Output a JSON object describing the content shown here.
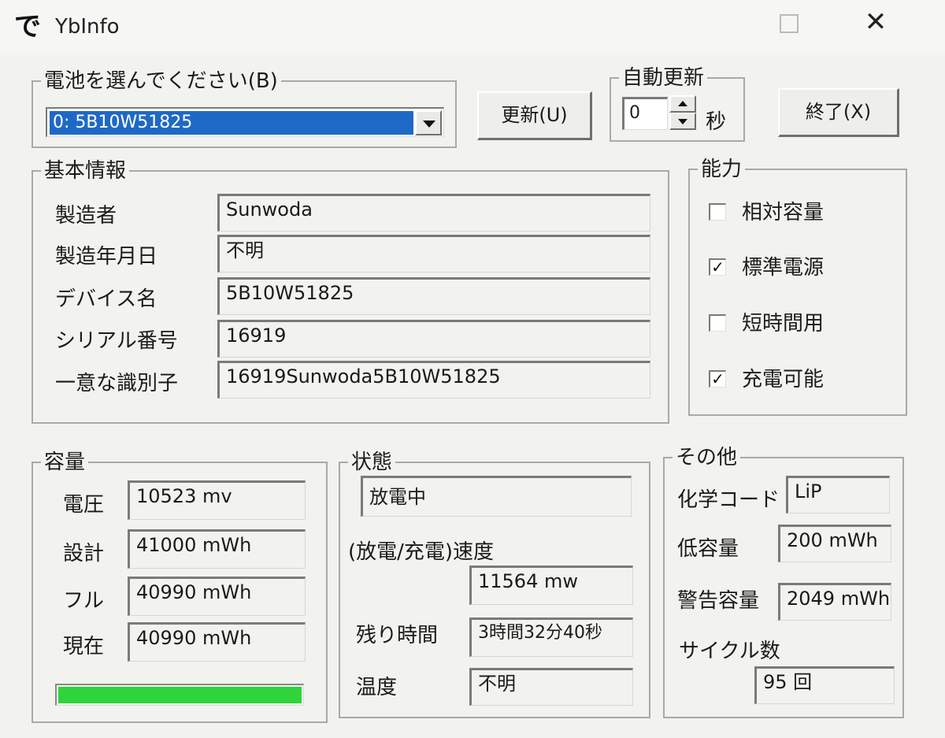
{
  "window": {
    "title": "YbInfo",
    "app_icon": "で",
    "close_glyph": "✕"
  },
  "battery_select": {
    "legend": "電池を選んでください(B)",
    "selected": "0: 5B10W51825",
    "refresh_label": "更新(U)"
  },
  "auto_update": {
    "legend": "自動更新",
    "value": "0",
    "unit": "秒"
  },
  "exit_label": "終了(X)",
  "basic_info": {
    "legend": "基本情報",
    "fields": [
      {
        "label": "製造者",
        "value": "Sunwoda"
      },
      {
        "label": "製造年月日",
        "value": "不明"
      },
      {
        "label": "デバイス名",
        "value": "5B10W51825"
      },
      {
        "label": "シリアル番号",
        "value": "16919"
      },
      {
        "label": "一意な識別子",
        "value": "16919Sunwoda5B10W51825"
      }
    ]
  },
  "capability": {
    "legend": "能力",
    "items": [
      {
        "label": "相対容量",
        "checked": false,
        "mark": ""
      },
      {
        "label": "標準電源",
        "checked": true,
        "mark": "✓"
      },
      {
        "label": "短時間用",
        "checked": false,
        "mark": ""
      },
      {
        "label": "充電可能",
        "checked": true,
        "mark": "✓"
      }
    ]
  },
  "capacity": {
    "legend": "容量",
    "fields": [
      {
        "label": "電圧",
        "value": "10523 mv"
      },
      {
        "label": "設計",
        "value": "41000 mWh"
      },
      {
        "label": "フル",
        "value": "40990 mWh"
      },
      {
        "label": "現在",
        "value": "40990 mWh"
      }
    ],
    "charge_fraction": 1.0,
    "bar_color": "#2fd43a"
  },
  "status": {
    "legend": "状態",
    "state": "放電中",
    "rate_label": "(放電/充電)速度",
    "rate_value": "11564 mw",
    "remaining_label": "残り時間",
    "remaining_value": "3時間32分40秒",
    "temperature_label": "温度",
    "temperature_value": "不明"
  },
  "other": {
    "legend": "その他",
    "chemistry_label": "化学コード",
    "chemistry_value": "LiP",
    "low_label": "低容量",
    "low_value": "200 mWh",
    "warning_label": "警告容量",
    "warning_value": "2049 mWh",
    "cycle_label": "サイクル数",
    "cycle_value": "95 回"
  }
}
